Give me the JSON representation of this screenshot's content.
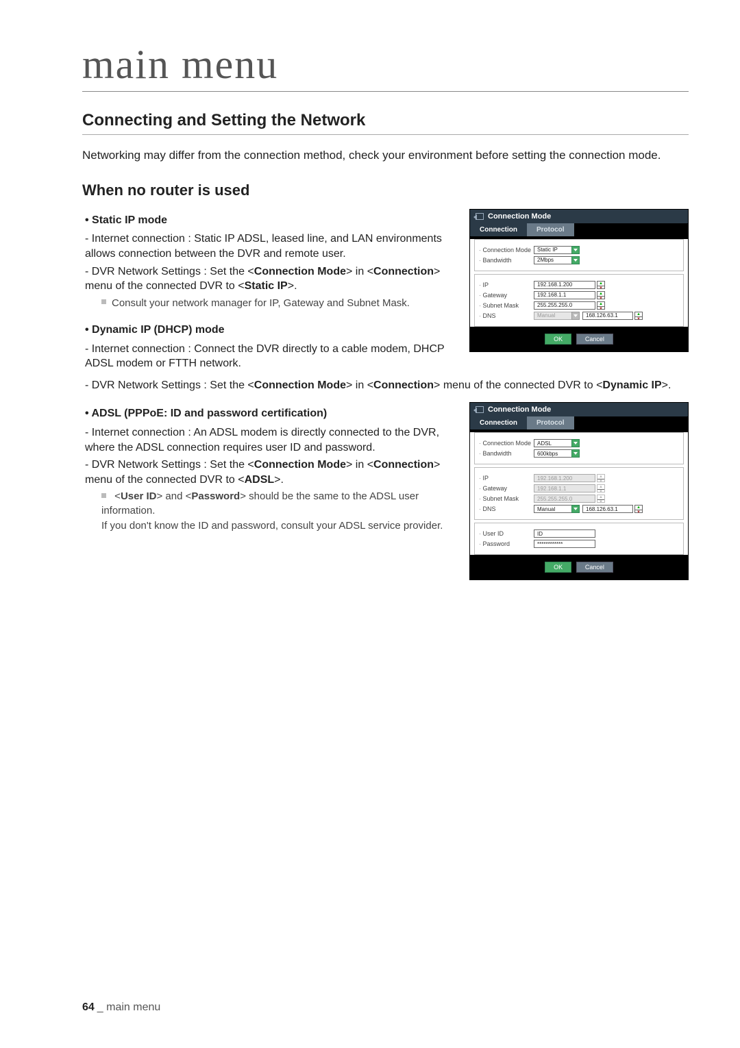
{
  "chapter_title": "main menu",
  "section_title": "Connecting and Setting the Network",
  "intro": "Networking may differ from the connection method, check your environment before setting the connection mode.",
  "subsection_title": "When no router is used",
  "static_ip": {
    "heading": "Static IP mode",
    "p1a": "Internet connection : Static IP ADSL, leased line, and LAN environments allows connection between the DVR and remote user.",
    "p2_pre": "DVR Network Settings : Set the <",
    "p2_b1": "Connection Mode",
    "p2_mid": "> in <",
    "p2_b2": "Connection",
    "p2_mid2": "> menu of the connected DVR to <",
    "p2_b3": "Static IP",
    "p2_post": ">.",
    "note": "Consult your network manager for IP, Gateway and Subnet Mask."
  },
  "dhcp": {
    "heading": "Dynamic IP (DHCP) mode",
    "p1": "Internet connection : Connect the DVR directly to a cable modem, DHCP ADSL modem or FTTH network.",
    "p2_pre": "DVR Network Settings : Set the <",
    "p2_b1": "Connection Mode",
    "p2_mid": "> in <",
    "p2_b2": "Connection",
    "p2_mid2": "> menu of the connected DVR to <",
    "p2_b3": "Dynamic IP",
    "p2_post": ">."
  },
  "adsl": {
    "heading": "ADSL (PPPoE: ID and password certification)",
    "p1": "Internet connection : An ADSL modem is directly connected to the DVR, where the ADSL connection requires user ID and password.",
    "p2_pre": "DVR Network Settings : Set the <",
    "p2_b1": "Connection Mode",
    "p2_mid": "> in <",
    "p2_b2": "Connection",
    "p2_mid2": "> menu of the connected DVR to <",
    "p2_b3": "ADSL",
    "p2_post": ">.",
    "note_pre": "<",
    "note_b1": "User ID",
    "note_mid": "> and <",
    "note_b2": "Password",
    "note_post": "> should be the same to the ADSL user information.",
    "note2": "If you don't know the ID and password, consult your ADSL service provider."
  },
  "shot1": {
    "title": "Connection Mode",
    "tab_active": "Connection",
    "tab_inactive": "Protocol",
    "rows": {
      "conn_mode_label": "Connection Mode",
      "conn_mode_val": "Static IP",
      "bandwidth_label": "Bandwidth",
      "bandwidth_val": "2Mbps",
      "ip_label": "IP",
      "ip_val": "192.168.1.200",
      "gateway_label": "Gateway",
      "gateway_val": "192.168.1.1",
      "subnet_label": "Subnet Mask",
      "subnet_val": "255.255.255.0",
      "dns_label": "DNS",
      "dns_mode": "Manual",
      "dns_val": "168.126.63.1"
    },
    "ok": "OK",
    "cancel": "Cancel"
  },
  "shot2": {
    "title": "Connection Mode",
    "tab_active": "Connection",
    "tab_inactive": "Protocol",
    "rows": {
      "conn_mode_label": "Connection Mode",
      "conn_mode_val": "ADSL",
      "bandwidth_label": "Bandwidth",
      "bandwidth_val": "600kbps",
      "ip_label": "IP",
      "ip_val": "192.168.1.200",
      "gateway_label": "Gateway",
      "gateway_val": "192.168.1.1",
      "subnet_label": "Subnet Mask",
      "subnet_val": "255.255.255.0",
      "dns_label": "DNS",
      "dns_mode": "Manual",
      "dns_val": "168.126.63.1",
      "userid_label": "User ID",
      "userid_val": "ID",
      "password_label": "Password",
      "password_val": "************"
    },
    "ok": "OK",
    "cancel": "Cancel"
  },
  "footer": {
    "page_num": "64",
    "suffix": "_ main menu"
  }
}
